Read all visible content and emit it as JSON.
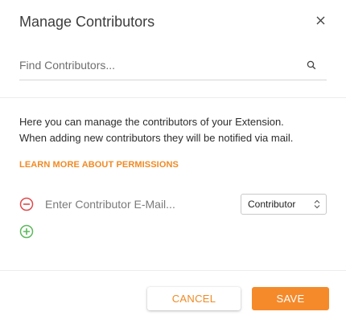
{
  "dialog": {
    "title": "Manage Contributors",
    "close_icon": "close-icon"
  },
  "search": {
    "placeholder": "Find Contributors...",
    "value": "",
    "icon": "search-icon"
  },
  "description": {
    "line1": "Here you can manage the contributors of your Extension.",
    "line2": "When adding new contributors they will be notified via mail."
  },
  "learn_more": {
    "label": "LEARN MORE ABOUT PERMISSIONS"
  },
  "contributors": [
    {
      "email_placeholder": "Enter Contributor E-Mail...",
      "email_value": "",
      "role": "Contributor",
      "remove_icon": "remove-circle-icon"
    }
  ],
  "add_icon": "add-circle-icon",
  "actions": {
    "cancel_label": "CANCEL",
    "save_label": "SAVE"
  },
  "colors": {
    "accent": "#f58a2b",
    "remove": "#e04a4a",
    "add": "#5cb85c",
    "text": "#2d2d2d"
  }
}
